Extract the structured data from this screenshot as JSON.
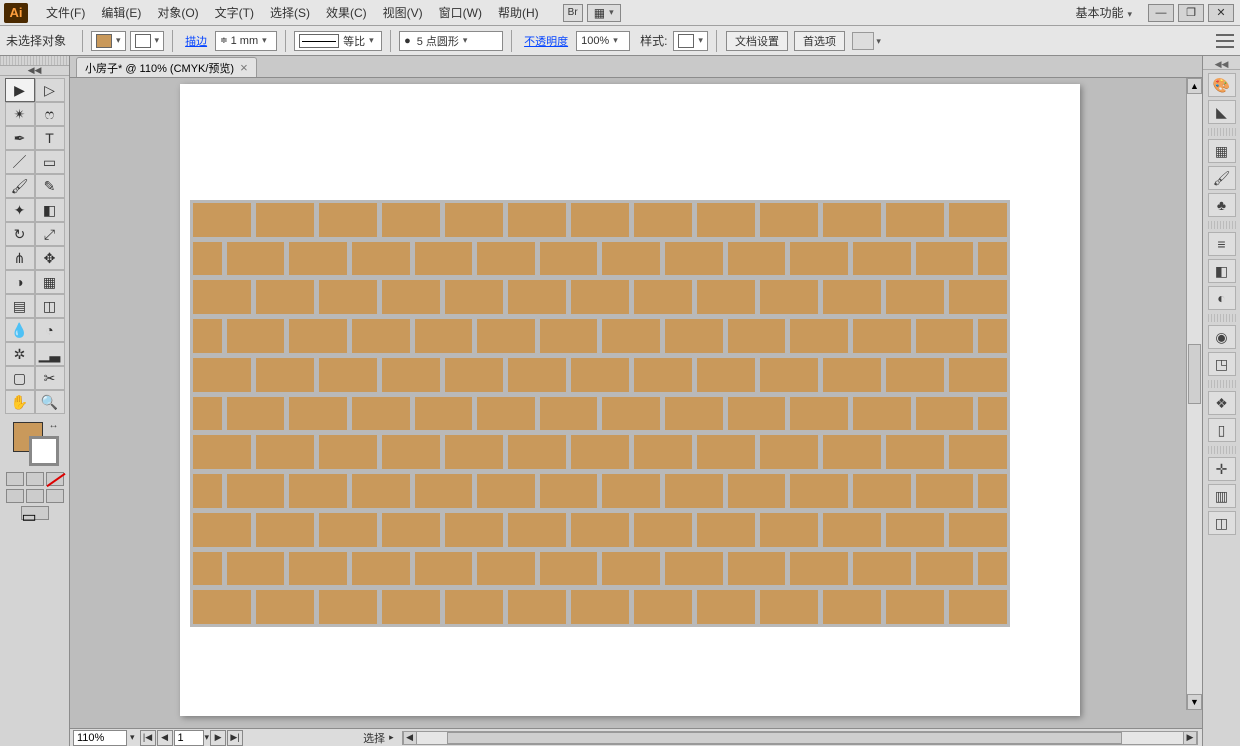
{
  "app": {
    "logo": "Ai",
    "workspace_label": "基本功能"
  },
  "menus": [
    "文件(F)",
    "编辑(E)",
    "对象(O)",
    "文字(T)",
    "选择(S)",
    "效果(C)",
    "视图(V)",
    "窗口(W)",
    "帮助(H)"
  ],
  "window_buttons": {
    "min": "—",
    "max": "❐",
    "close": "✕"
  },
  "aux_buttons": {
    "bridge": "Br"
  },
  "control": {
    "no_selection": "未选择对象",
    "stroke_link": "描边",
    "stroke_width": "1 mm",
    "scale_label": "等比",
    "brush_label": "5 点圆形",
    "brush_dot": "●",
    "opacity_link": "不透明度",
    "opacity_value": "100%",
    "style_label": "样式:",
    "doc_setup": "文档设置",
    "prefs": "首选项"
  },
  "tab": {
    "title": "小房子* @ 110% (CMYK/预览)",
    "close": "×"
  },
  "status": {
    "zoom": "110%",
    "artboard_num": "1",
    "tool_name": "选择"
  },
  "tools": [
    {
      "name": "selection-tool",
      "g": "▶",
      "active": true
    },
    {
      "name": "direct-selection-tool",
      "g": "▷"
    },
    {
      "name": "magic-wand-tool",
      "g": "✴"
    },
    {
      "name": "lasso-tool",
      "g": "ෆ"
    },
    {
      "name": "pen-tool",
      "g": "✒"
    },
    {
      "name": "type-tool",
      "g": "T"
    },
    {
      "name": "line-segment-tool",
      "g": "／"
    },
    {
      "name": "rectangle-tool",
      "g": "▭"
    },
    {
      "name": "paintbrush-tool",
      "g": "🖌"
    },
    {
      "name": "pencil-tool",
      "g": "✎"
    },
    {
      "name": "blob-brush-tool",
      "g": "✦"
    },
    {
      "name": "eraser-tool",
      "g": "◧"
    },
    {
      "name": "rotate-tool",
      "g": "↻"
    },
    {
      "name": "scale-tool",
      "g": "⤢"
    },
    {
      "name": "width-tool",
      "g": "⋔"
    },
    {
      "name": "free-transform-tool",
      "g": "✥"
    },
    {
      "name": "shape-builder-tool",
      "g": "◑"
    },
    {
      "name": "perspective-grid-tool",
      "g": "▦"
    },
    {
      "name": "mesh-tool",
      "g": "▤"
    },
    {
      "name": "gradient-tool",
      "g": "◫"
    },
    {
      "name": "eyedropper-tool",
      "g": "💧"
    },
    {
      "name": "blend-tool",
      "g": "◔"
    },
    {
      "name": "symbol-sprayer-tool",
      "g": "✲"
    },
    {
      "name": "column-graph-tool",
      "g": "▁▃"
    },
    {
      "name": "artboard-tool",
      "g": "▢"
    },
    {
      "name": "slice-tool",
      "g": "✂"
    },
    {
      "name": "hand-tool",
      "g": "✋"
    },
    {
      "name": "zoom-tool",
      "g": "🔍"
    }
  ],
  "right_panels": [
    {
      "name": "color-panel",
      "g": "🎨"
    },
    {
      "name": "color-guide-panel",
      "g": "◣"
    },
    {
      "sep": true
    },
    {
      "name": "swatches-panel",
      "g": "▦"
    },
    {
      "name": "brushes-panel",
      "g": "🖌"
    },
    {
      "name": "symbols-panel",
      "g": "♣"
    },
    {
      "sep": true
    },
    {
      "name": "stroke-panel",
      "g": "≡"
    },
    {
      "name": "gradient-panel",
      "g": "◧"
    },
    {
      "name": "transparency-panel",
      "g": "◐"
    },
    {
      "sep": true
    },
    {
      "name": "appearance-panel",
      "g": "◉"
    },
    {
      "name": "graphic-styles-panel",
      "g": "◳"
    },
    {
      "sep": true
    },
    {
      "name": "layers-panel",
      "g": "❖"
    },
    {
      "name": "artboards-panel",
      "g": "▯"
    },
    {
      "sep": true
    },
    {
      "name": "transform-panel",
      "g": "✛"
    },
    {
      "name": "align-panel",
      "g": "▥"
    },
    {
      "name": "pathfinder-panel",
      "g": "◫"
    }
  ],
  "colors": {
    "brick": "#c9995b",
    "mortar": "#b9b9b9"
  }
}
